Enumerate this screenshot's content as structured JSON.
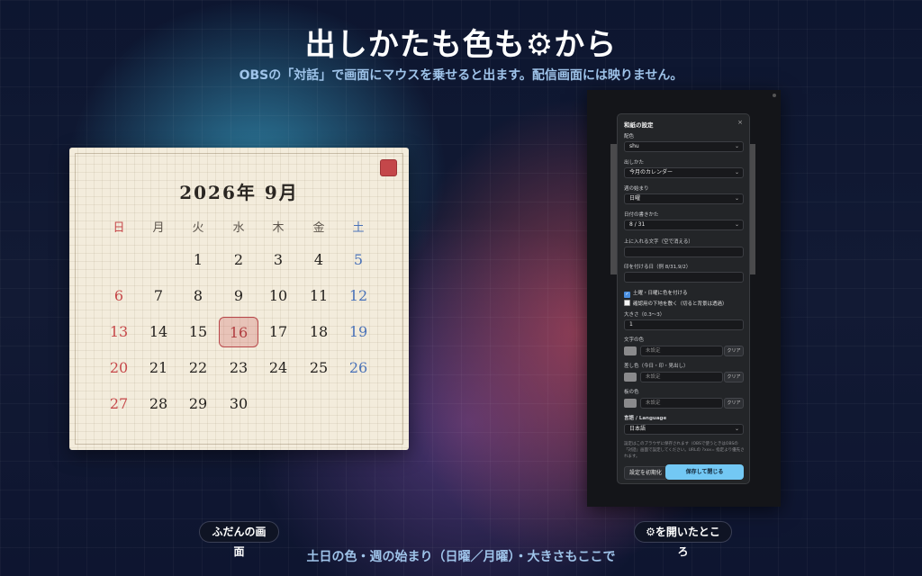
{
  "headline": "出しかたも色も⚙から",
  "subline": "OBSの「対話」で画面にマウスを乗せると出ます。配信画面には映りません。",
  "calendar": {
    "title": "2026年 9月",
    "weekdays": [
      "日",
      "月",
      "火",
      "水",
      "木",
      "金",
      "土"
    ],
    "first_weekday_index": 2,
    "days_in_month": 30,
    "today": 16,
    "colors": {
      "sunday": "#c6484a",
      "saturday": "#4a72b8",
      "today_border": "#b8474a",
      "paper": "#f3ecdc"
    }
  },
  "settings": {
    "title": "和紙の設定",
    "close": "×",
    "color_label": "配色",
    "color_value": "shu",
    "display_label": "出しかた",
    "display_value": "今月のカレンダー",
    "week_start_label": "週の始まり",
    "week_start_value": "日曜",
    "date_format_label": "日付の書きかた",
    "date_format_value": "8 / 31",
    "top_text_label": "上に入れる文字（空で消える）",
    "top_text_value": "",
    "mark_dates_label": "印を付ける日（例 8/31,9/2）",
    "mark_dates_value": "",
    "check_weekend": "土曜・日曜に色を付ける",
    "check_weekend_checked": true,
    "check_bg": "確認用の下地を敷く（切ると背景は透過）",
    "check_bg_checked": false,
    "size_label": "大きさ（0.3〜3）",
    "size_value": "1",
    "text_color_label": "文字の色",
    "accent_color_label": "差し色（今日・印・見出し）",
    "board_color_label": "板の色",
    "unset_placeholder": "未設定",
    "clear_label": "クリア",
    "language_label": "言語 / Language",
    "language_value": "日本語",
    "note": "設定はこのブラウザに保存されます（OBSで使うときはOBSの「対話」画面で設定してください。URLの ?xxx= 指定より優先されます。",
    "reset_label": "設定を初期化",
    "save_label": "保存して閉じる",
    "chevron": "⌄"
  },
  "captions": {
    "left": "ふだんの画面",
    "right": "⚙を開いたところ"
  },
  "footer": "土日の色・週の始まり（日曜／月曜）・大きさもここで"
}
